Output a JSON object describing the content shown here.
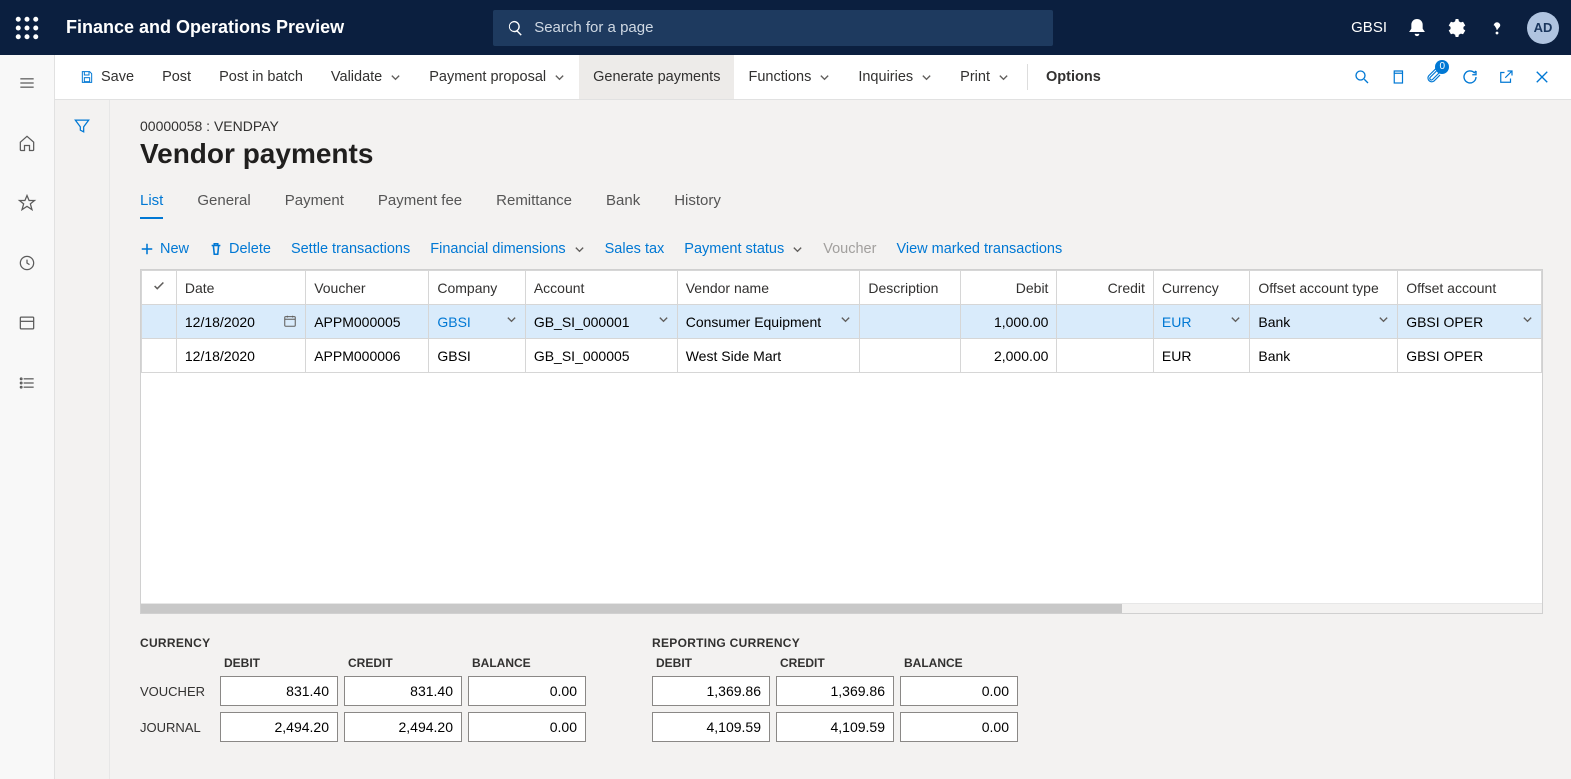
{
  "header": {
    "app_title": "Finance and Operations Preview",
    "search_placeholder": "Search for a page",
    "company": "GBSI",
    "avatar_initials": "AD",
    "notify_count": "0"
  },
  "actionbar": {
    "save": "Save",
    "post": "Post",
    "post_batch": "Post in batch",
    "validate": "Validate",
    "payment_proposal": "Payment proposal",
    "generate_payments": "Generate payments",
    "functions": "Functions",
    "inquiries": "Inquiries",
    "print": "Print",
    "options": "Options"
  },
  "page": {
    "breadcrumb": "00000058 : VENDPAY",
    "title": "Vendor payments"
  },
  "tabs": {
    "list": "List",
    "general": "General",
    "payment": "Payment",
    "payment_fee": "Payment fee",
    "remittance": "Remittance",
    "bank": "Bank",
    "history": "History"
  },
  "grid_toolbar": {
    "new": "New",
    "delete": "Delete",
    "settle": "Settle transactions",
    "fin_dim": "Financial dimensions",
    "sales_tax": "Sales tax",
    "payment_status": "Payment status",
    "voucher": "Voucher",
    "view_marked": "View marked transactions"
  },
  "grid": {
    "cols": {
      "date": "Date",
      "voucher": "Voucher",
      "company": "Company",
      "account": "Account",
      "vendor_name": "Vendor name",
      "description": "Description",
      "debit": "Debit",
      "credit": "Credit",
      "currency": "Currency",
      "offset_type": "Offset account type",
      "offset_account": "Offset account"
    },
    "rows": [
      {
        "date": "12/18/2020",
        "voucher": "APPM000005",
        "company": "GBSI",
        "account": "GB_SI_000001",
        "vendor_name": "Consumer Equipment",
        "description": "",
        "debit": "1,000.00",
        "credit": "",
        "currency": "EUR",
        "offset_type": "Bank",
        "offset_account": "GBSI OPER",
        "selected": true
      },
      {
        "date": "12/18/2020",
        "voucher": "APPM000006",
        "company": "GBSI",
        "account": "GB_SI_000005",
        "vendor_name": "West Side Mart",
        "description": "",
        "debit": "2,000.00",
        "credit": "",
        "currency": "EUR",
        "offset_type": "Bank",
        "offset_account": "GBSI OPER",
        "selected": false
      }
    ]
  },
  "totals": {
    "currency_label": "CURRENCY",
    "reporting_label": "REPORTING CURRENCY",
    "debit_label": "DEBIT",
    "credit_label": "CREDIT",
    "balance_label": "BALANCE",
    "voucher_label": "VOUCHER",
    "journal_label": "JOURNAL",
    "currency": {
      "voucher": {
        "debit": "831.40",
        "credit": "831.40",
        "balance": "0.00"
      },
      "journal": {
        "debit": "2,494.20",
        "credit": "2,494.20",
        "balance": "0.00"
      }
    },
    "reporting": {
      "voucher": {
        "debit": "1,369.86",
        "credit": "1,369.86",
        "balance": "0.00"
      },
      "journal": {
        "debit": "4,109.59",
        "credit": "4,109.59",
        "balance": "0.00"
      }
    }
  }
}
